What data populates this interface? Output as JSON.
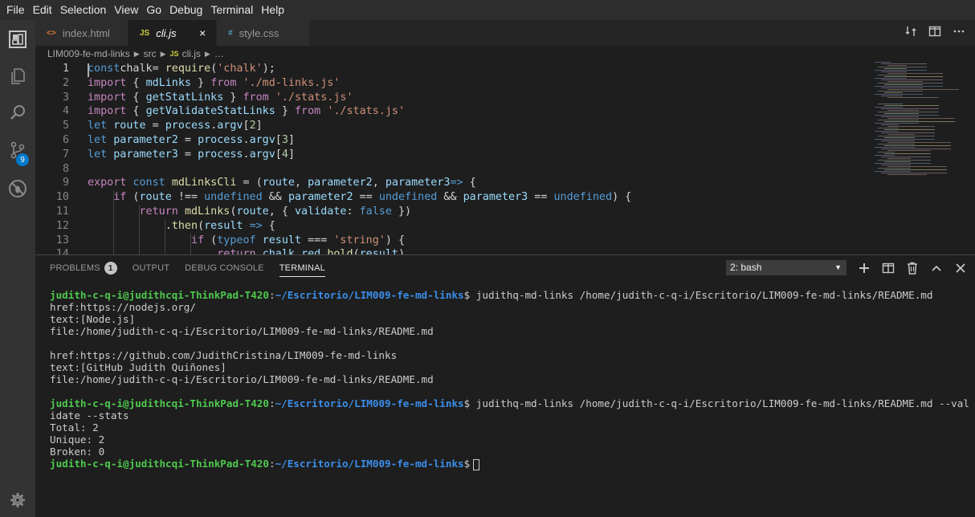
{
  "menu": [
    "File",
    "Edit",
    "Selection",
    "View",
    "Go",
    "Debug",
    "Terminal",
    "Help"
  ],
  "activity_bar": {
    "icons": [
      "extensions-logo-icon",
      "files-icon",
      "search-icon",
      "source-control-icon",
      "debug-icon",
      "settings-gear-icon"
    ],
    "scm_badge": "9"
  },
  "tabs": [
    {
      "icon": "<>",
      "label": "index.html",
      "icon_color": "#e37933",
      "active": false
    },
    {
      "icon": "JS",
      "label": "cli.js",
      "icon_color": "#cbcb41",
      "active": true,
      "close": "×"
    },
    {
      "icon": "#",
      "label": "style.css",
      "icon_color": "#519aba",
      "active": false
    }
  ],
  "breadcrumb": [
    "LIM009-fe-md-links",
    "src",
    "cli.js",
    "…"
  ],
  "breadcrumb_js_tag": "JS",
  "editor": {
    "lines": [
      {
        "n": "1",
        "tokens": [
          [
            "kw",
            "const"
          ],
          [
            "",
            "chalk"
          ],
          [
            "",
            ""
          ],
          [
            "",
            "= "
          ],
          [
            "fn",
            "require"
          ],
          [
            "",
            "("
          ],
          [
            "str",
            "'chalk'"
          ],
          [
            "",
            ");"
          ]
        ]
      },
      {
        "n": "2",
        "tokens": [
          [
            "kwc",
            "import"
          ],
          [
            "",
            " { "
          ],
          [
            "var",
            "mdLinks"
          ],
          [
            "",
            " } "
          ],
          [
            "kwc",
            "from"
          ],
          [
            "",
            " "
          ],
          [
            "str",
            "'./md-links.js'"
          ]
        ]
      },
      {
        "n": "3",
        "tokens": [
          [
            "kwc",
            "import"
          ],
          [
            "",
            " { "
          ],
          [
            "var",
            "getStatLinks"
          ],
          [
            "",
            " } "
          ],
          [
            "kwc",
            "from"
          ],
          [
            "",
            " "
          ],
          [
            "str",
            "'./stats.js'"
          ]
        ]
      },
      {
        "n": "4",
        "tokens": [
          [
            "kwc",
            "import"
          ],
          [
            "",
            " { "
          ],
          [
            "var",
            "getValidateStatLinks"
          ],
          [
            "",
            " } "
          ],
          [
            "kwc",
            "from"
          ],
          [
            "",
            " "
          ],
          [
            "str",
            "'./stats.js'"
          ]
        ]
      },
      {
        "n": "5",
        "tokens": [
          [
            "kw",
            "let"
          ],
          [
            "",
            " "
          ],
          [
            "var",
            "route"
          ],
          [
            "",
            " = "
          ],
          [
            "var",
            "process"
          ],
          [
            "",
            "."
          ],
          [
            "var",
            "argv"
          ],
          [
            "",
            "["
          ],
          [
            "num",
            "2"
          ],
          [
            "",
            "]"
          ]
        ]
      },
      {
        "n": "6",
        "tokens": [
          [
            "kw",
            "let"
          ],
          [
            "",
            " "
          ],
          [
            "var",
            "parameter2"
          ],
          [
            "",
            " = "
          ],
          [
            "var",
            "process"
          ],
          [
            "",
            "."
          ],
          [
            "var",
            "argv"
          ],
          [
            "",
            "["
          ],
          [
            "num",
            "3"
          ],
          [
            "",
            "]"
          ]
        ]
      },
      {
        "n": "7",
        "tokens": [
          [
            "kw",
            "let"
          ],
          [
            "",
            " "
          ],
          [
            "var",
            "parameter3"
          ],
          [
            "",
            " = "
          ],
          [
            "var",
            "process"
          ],
          [
            "",
            "."
          ],
          [
            "var",
            "argv"
          ],
          [
            "",
            "["
          ],
          [
            "num",
            "4"
          ],
          [
            "",
            "]"
          ]
        ]
      },
      {
        "n": "8",
        "tokens": []
      },
      {
        "n": "9",
        "tokens": [
          [
            "kwc",
            "export"
          ],
          [
            "",
            " "
          ],
          [
            "kw",
            "const"
          ],
          [
            "",
            " "
          ],
          [
            "fn",
            "mdLinksCli"
          ],
          [
            "",
            " = ("
          ],
          [
            "var",
            "route"
          ],
          [
            "",
            ", "
          ],
          [
            "var",
            "parameter2"
          ],
          [
            "",
            ", "
          ],
          [
            "var",
            "parameter3"
          ],
          [
            ") "
          ],
          [
            "kw",
            "=>"
          ],
          [
            "",
            " {"
          ]
        ]
      },
      {
        "n": "10",
        "tokens": [
          [
            "",
            "    "
          ],
          [
            "kwc",
            "if"
          ],
          [
            "",
            " ("
          ],
          [
            "var",
            "route"
          ],
          [
            "",
            " !== "
          ],
          [
            "kw",
            "undefined"
          ],
          [
            "",
            " && "
          ],
          [
            "var",
            "parameter2"
          ],
          [
            "",
            " == "
          ],
          [
            "kw",
            "undefined"
          ],
          [
            "",
            " && "
          ],
          [
            "var",
            "parameter3"
          ],
          [
            "",
            " == "
          ],
          [
            "kw",
            "undefined"
          ],
          [
            "",
            ") {"
          ]
        ]
      },
      {
        "n": "11",
        "tokens": [
          [
            "",
            "        "
          ],
          [
            "kwc",
            "return"
          ],
          [
            "",
            " "
          ],
          [
            "fn",
            "mdLinks"
          ],
          [
            "",
            "("
          ],
          [
            "var",
            "route"
          ],
          [
            "",
            ", { "
          ],
          [
            "var",
            "validate"
          ],
          [
            "",
            ": "
          ],
          [
            "kw",
            "false"
          ],
          [
            "",
            " })"
          ]
        ]
      },
      {
        "n": "12",
        "tokens": [
          [
            "",
            "            ."
          ],
          [
            "fn",
            "then"
          ],
          [
            "",
            "("
          ],
          [
            "var",
            "result"
          ],
          [
            "",
            " "
          ],
          [
            "kw",
            "=>"
          ],
          [
            "",
            " {"
          ]
        ]
      },
      {
        "n": "13",
        "tokens": [
          [
            "",
            "                "
          ],
          [
            "kwc",
            "if"
          ],
          [
            "",
            " ("
          ],
          [
            "kw",
            "typeof"
          ],
          [
            "",
            " "
          ],
          [
            "var",
            "result"
          ],
          [
            "",
            " === "
          ],
          [
            "str",
            "'string'"
          ],
          [
            "",
            ") {"
          ]
        ]
      },
      {
        "n": "14",
        "tokens": [
          [
            "",
            "                    "
          ],
          [
            "kwc",
            "return"
          ],
          [
            "",
            " "
          ],
          [
            "var",
            "chalk"
          ],
          [
            "",
            "."
          ],
          [
            "var",
            "red"
          ],
          [
            "",
            "."
          ],
          [
            "fn",
            "bold"
          ],
          [
            "",
            "("
          ],
          [
            "var",
            "result"
          ],
          [
            "",
            ")"
          ]
        ]
      }
    ]
  },
  "panel": {
    "tabs": [
      "PROBLEMS",
      "OUTPUT",
      "DEBUG CONSOLE",
      "TERMINAL"
    ],
    "problems_badge": "1",
    "shell": "2: bash",
    "shell_caret": "▼"
  },
  "terminal": {
    "user": "judith-c-q-i@judithcqi-ThinkPad-T420",
    "path": "~/Escritorio/LIM009-fe-md-links",
    "lines": [
      {
        "type": "prompt",
        "cmd": " judithq-md-links /home/judith-c-q-i/Escritorio/LIM009-fe-md-links/README.md"
      },
      {
        "type": "out",
        "text": "href:https://nodejs.org/"
      },
      {
        "type": "out",
        "text": "text:[Node.js]"
      },
      {
        "type": "out",
        "text": "file:/home/judith-c-q-i/Escritorio/LIM009-fe-md-links/README.md"
      },
      {
        "type": "out",
        "text": ""
      },
      {
        "type": "out",
        "text": "href:https://github.com/JudithCristina/LIM009-fe-md-links"
      },
      {
        "type": "out",
        "text": "text:[GitHub Judith Quiñones]"
      },
      {
        "type": "out",
        "text": "file:/home/judith-c-q-i/Escritorio/LIM009-fe-md-links/README.md"
      },
      {
        "type": "out",
        "text": ""
      },
      {
        "type": "prompt",
        "cmd": " judithq-md-links /home/judith-c-q-i/Escritorio/LIM009-fe-md-links/README.md --val"
      },
      {
        "type": "out",
        "text": "idate --stats"
      },
      {
        "type": "out",
        "text": "Total: 2"
      },
      {
        "type": "out",
        "text": "Unique: 2"
      },
      {
        "type": "out",
        "text": "Broken: 0"
      },
      {
        "type": "prompt-cursor",
        "cmd": ""
      }
    ]
  },
  "colors": {
    "accent": "#007acc",
    "prompt_user": "#4ec94e",
    "prompt_path": "#3b8eea"
  }
}
